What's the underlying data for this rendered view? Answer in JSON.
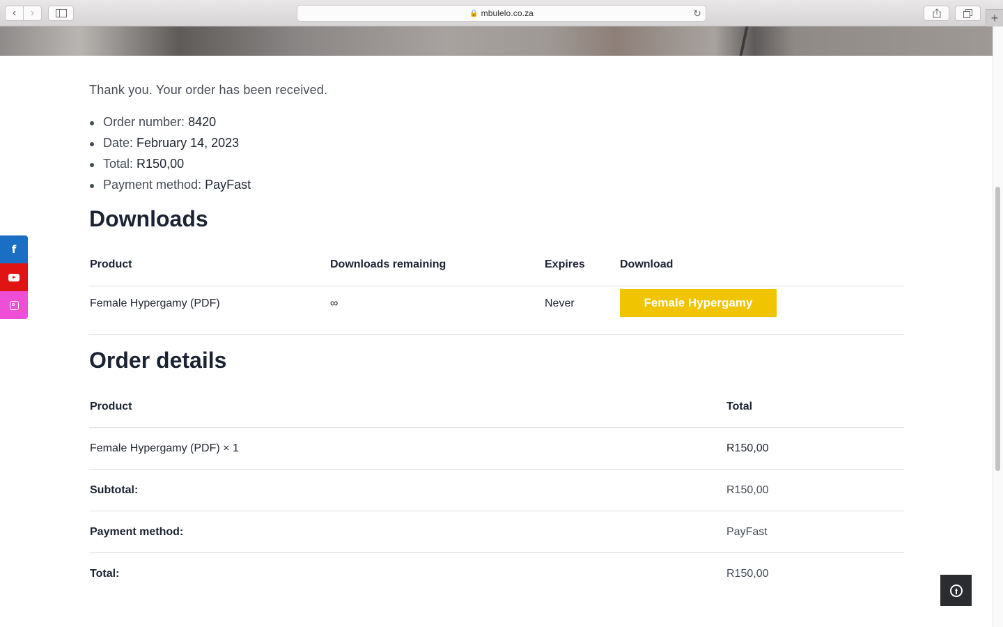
{
  "browser": {
    "url": "mbulelo.co.za"
  },
  "order": {
    "thanks": "Thank you. Your order has been received.",
    "overview": [
      {
        "label": "Order number:",
        "value": "8420"
      },
      {
        "label": "Date:",
        "value": "February 14, 2023"
      },
      {
        "label": "Total:",
        "value": "R150,00"
      },
      {
        "label": "Payment method:",
        "value": "PayFast"
      }
    ]
  },
  "downloads": {
    "title": "Downloads",
    "headers": [
      "Product",
      "Downloads remaining",
      "Expires",
      "Download"
    ],
    "row": {
      "product": "Female Hypergamy (PDF)",
      "remaining": "∞",
      "expires": "Never",
      "button": "Female Hypergamy"
    }
  },
  "order_details": {
    "title": "Order details",
    "headers": [
      "Product",
      "Total"
    ],
    "item": {
      "product": "Female Hypergamy (PDF)",
      "qty": " × 1",
      "total": "R150,00"
    },
    "totals": [
      {
        "label": "Subtotal:",
        "value": "R150,00"
      },
      {
        "label": "Payment method:",
        "value": "PayFast"
      },
      {
        "label": "Total:",
        "value": "R150,00"
      }
    ]
  },
  "social": {
    "facebook_glyph": "f"
  },
  "colors": {
    "button": "#f0c400",
    "facebook": "#1a6ec3",
    "youtube": "#e11414",
    "instagram": "#ee4fd6"
  }
}
